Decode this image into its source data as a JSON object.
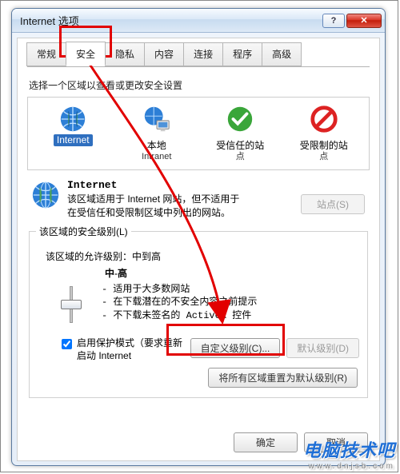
{
  "window": {
    "title": "Internet 选项",
    "help_glyph": "?",
    "close_glyph": "✕"
  },
  "tabs": [
    "常规",
    "安全",
    "隐私",
    "内容",
    "连接",
    "程序",
    "高级"
  ],
  "active_tab_index": 1,
  "security": {
    "zones_label": "选择一个区域以查看或更改安全设置",
    "zones": [
      {
        "name": "Internet",
        "sub": ""
      },
      {
        "name": "本地",
        "sub": "Intranet"
      },
      {
        "name": "受信任的站",
        "sub": "点"
      },
      {
        "name": "受限制的站",
        "sub": "点"
      }
    ],
    "selected_zone_index": 0,
    "desc_title": "Internet",
    "desc_line1": "该区域适用于 Internet 网站，但不适用于",
    "desc_line2": "在受信任和受限制区域中列出的网站。",
    "sites_button": "站点(S)",
    "group_legend": "该区域的安全级别(L)",
    "allowed_label": "该区域的允许级别：中到高",
    "level_name": "中-高",
    "bullets": [
      "适用于大多数网站",
      "在下载潜在的不安全内容之前提示",
      "不下载未签名的 ActiveX 控件"
    ],
    "protect_label1": "启用保护模式（要求重新",
    "protect_label2": "启动 Internet",
    "custom_button": "自定义级别(C)...",
    "default_button": "默认级别(D)",
    "reset_button": "将所有区域重置为默认级别(R)"
  },
  "dialog": {
    "ok": "确定",
    "cancel": "取消"
  },
  "watermark": {
    "text": "电脑技术吧",
    "url": "www.dnjsb.com"
  }
}
